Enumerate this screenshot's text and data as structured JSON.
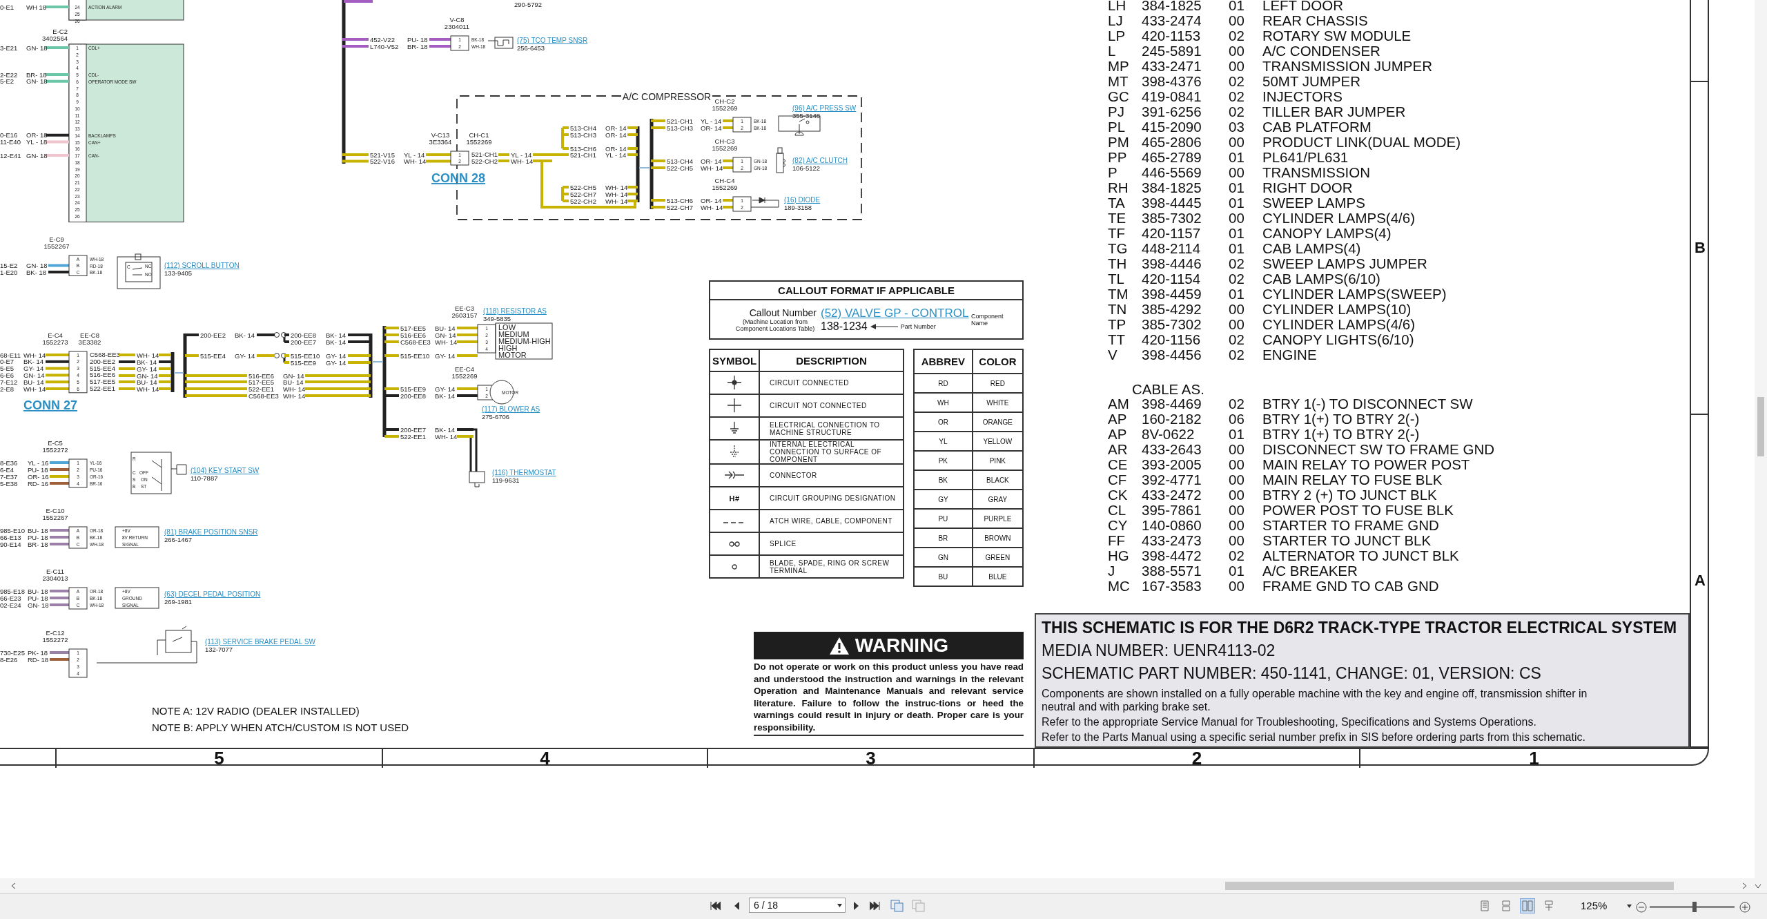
{
  "schematic": {
    "module": {
      "sections": [
        {
          "pins": [
            {
              "number": "24",
              "label": "ACTION ALARM",
              "wire": {
                "circuit": "0-E1",
                "wire": "WH 18",
                "color": "#6cc7a8"
              }
            },
            {
              "number": "25"
            },
            {
              "number": "26"
            }
          ]
        },
        {
          "refs": [
            "E-C2",
            "3402564"
          ],
          "pins": [
            {
              "number": "1",
              "label": "CDL+",
              "wire": {
                "circuit": "3-E21",
                "wire": "GN- 18",
                "color": "#6cc7a8"
              }
            },
            {
              "number": "2"
            },
            {
              "number": "3"
            },
            {
              "number": "4"
            },
            {
              "number": "5",
              "label": "CDL-",
              "wire": {
                "circuit": "2-E22",
                "wire": "BR- 18",
                "color": "#6cc7a8"
              }
            },
            {
              "number": "6",
              "label": "OPERATOR MODE SW",
              "wire": {
                "circuit": "5-E2",
                "wire": "GN- 18",
                "color": "#6cc7a8"
              }
            },
            {
              "number": "7"
            },
            {
              "number": "8"
            },
            {
              "number": "9"
            },
            {
              "number": "10"
            },
            {
              "number": "11"
            },
            {
              "number": "12"
            },
            {
              "number": "13"
            },
            {
              "number": "14",
              "label": "BACKLAMPS",
              "wire": {
                "circuit": "0-E16",
                "wire": "OR- 18",
                "color": "#222222"
              }
            },
            {
              "number": "15",
              "label": "CAN+",
              "wire": {
                "circuit": "11-E40",
                "wire": "YL - 18",
                "color": "#f0c4cc"
              }
            },
            {
              "number": "16"
            },
            {
              "number": "17",
              "label": "CAN-",
              "wire": {
                "circuit": "12-E41",
                "wire": "GN- 18",
                "color": "#f0c4cc"
              }
            },
            {
              "number": "18"
            },
            {
              "number": "19"
            },
            {
              "number": "20"
            },
            {
              "number": "21"
            },
            {
              "number": "22"
            },
            {
              "number": "23"
            },
            {
              "number": "24"
            },
            {
              "number": "25"
            },
            {
              "number": "26"
            }
          ]
        }
      ]
    },
    "top_part_number": "290-5792",
    "compressor_label": "A/C COMPRESSOR",
    "connectors": [
      {
        "refs": [
          [
            "V-C8",
            "2304011"
          ]
        ],
        "wires": [
          {
            "circuit": "452-V22",
            "wire": "PU- 18",
            "color": "#a35cbf"
          },
          {
            "circuit": "L740-V52",
            "wire": "BR- 18",
            "color": "#a35cbf"
          }
        ],
        "pins": [
          "1",
          "2"
        ],
        "pin_wires": [
          "BK-18",
          "WH-18"
        ],
        "device": {
          "kind": "temp_sensor"
        },
        "callout": "(75) TCO TEMP SNSR",
        "part_number": "256-6453"
      },
      {
        "refs": [
          [
            "V-C13",
            "3E3364"
          ],
          [
            "CH-C1",
            "1552269"
          ]
        ],
        "wires": [
          {
            "circuit": "521-V15",
            "wire": "YL - 14",
            "color": "#c8b400"
          },
          {
            "circuit": "522-V16",
            "wire": "WH- 14",
            "color": "#c8b400"
          }
        ],
        "pins": [
          "1",
          "2"
        ],
        "pin_wires": [
          "521-CH1",
          "522-CH2"
        ],
        "link": "CONN 28"
      },
      {
        "refs": [
          [
            "CH-C2",
            "1552269"
          ]
        ],
        "wires": [
          {
            "circuit": "521-CH1",
            "wire": "YL - 14",
            "color": "#c8b400"
          },
          {
            "circuit": "513-CH3",
            "wire": "OR- 14",
            "color": "#c8b400"
          }
        ],
        "pins": [
          "1",
          "2"
        ],
        "pin_wires": [
          "BK-18",
          "BK-18"
        ],
        "device": {
          "kind": "pressure_switch"
        },
        "callout": "(96) A/C PRESS SW",
        "part_number": "355-3148"
      },
      {
        "refs": [
          [
            "CH-C3",
            "1552269"
          ]
        ],
        "wires": [
          {
            "circuit": "513-CH4",
            "wire": "OR- 14",
            "color": "#c8b400"
          },
          {
            "circuit": "522-CH5",
            "wire": "WH- 14",
            "color": "#c8b400"
          }
        ],
        "pins": [
          "1",
          "2"
        ],
        "pin_wires": [
          "GN-18",
          "GN-18"
        ],
        "device": {
          "kind": "clutch"
        },
        "callout": "(82) A/C CLUTCH",
        "part_number": "106-5122"
      },
      {
        "refs": [
          [
            "CH-C4",
            "1552269"
          ]
        ],
        "wires": [
          {
            "circuit": "513-CH6",
            "wire": "OR- 14",
            "color": "#c8b400"
          },
          {
            "circuit": "522-CH7",
            "wire": "WH- 14",
            "color": "#c8b400"
          }
        ],
        "pins": [
          "1",
          "2"
        ],
        "device": {
          "kind": "diode"
        },
        "callout": "(16) DIODE",
        "part_number": "189-3158"
      },
      {
        "refs": [
          [
            "E-C9",
            "1552267"
          ]
        ],
        "wires": [
          {
            "circuit": "15-E2",
            "wire": "GN- 18",
            "color": "#4fa6d6"
          },
          {
            "circuit": "1-E20",
            "wire": "BK- 18",
            "color": "#222222"
          }
        ],
        "pins": [
          "A",
          "B",
          "C"
        ],
        "pin_wires": [
          "WH-18",
          "RD-18",
          "BK-18"
        ],
        "device": {
          "kind": "push_switch",
          "labels": [
            "C",
            "NC",
            "NO"
          ]
        },
        "callout": "(112) SCROLL BUTTON",
        "part_number": "133-9405"
      },
      {
        "refs": [
          [
            "E-C4",
            "1552273"
          ],
          [
            "EE-C8",
            "3E3382"
          ]
        ],
        "wires": [
          {
            "circuit": "68-E11",
            "wire": "WH- 14",
            "color": "#c8b400"
          },
          {
            "circuit": "0-E7",
            "wire": "BK- 14",
            "color": "#222222"
          },
          {
            "circuit": "5-E5",
            "wire": "GY- 14",
            "color": "#c8b400"
          },
          {
            "circuit": "6-E6",
            "wire": "GN- 14",
            "color": "#c8b400"
          },
          {
            "circuit": "7-E12",
            "wire": "BU- 14",
            "color": "#c8b400"
          },
          {
            "circuit": "2-E8",
            "wire": "WH- 14",
            "color": "#c8b400"
          }
        ],
        "pins": [
          "1",
          "2",
          "3",
          "4",
          "5",
          "6"
        ],
        "pin_wires": [
          "C568-EE3",
          "200-EE2",
          "515-EE4",
          "516-EE6",
          "517-EE5",
          "522-EE1"
        ],
        "link": "CONN 27"
      },
      {
        "refs": [
          [
            "EE-C3",
            "2603157"
          ]
        ],
        "wires": [
          {
            "circuit": "517-EE5",
            "wire": "BU- 14",
            "color": "#c8b400"
          },
          {
            "circuit": "516-EE6",
            "wire": "GN- 14",
            "color": "#c8b400"
          },
          {
            "circuit": "C568-EE3",
            "wire": "WH- 14",
            "color": "#c8b400"
          },
          {
            "circuit": "515-EE10",
            "wire": "GY- 14",
            "color": "#c8b400"
          }
        ],
        "pins": [
          "1",
          "2",
          "3",
          "4"
        ],
        "device": {
          "kind": "resistor",
          "labels": [
            "LOW",
            "MEDIUM",
            "MEDIUM-HIGH",
            "HIGH",
            "MOTOR"
          ]
        },
        "callout": "(118) RESISTOR AS",
        "part_number": "349-5835"
      },
      {
        "refs": [
          [
            "EE-C4",
            "1552269"
          ]
        ],
        "wires": [
          {
            "circuit": "515-EE9",
            "wire": "GY- 14",
            "color": "#c8b400"
          },
          {
            "circuit": "200-EE8",
            "wire": "BK- 14",
            "color": "#222222"
          }
        ],
        "pins": [
          "1",
          "2"
        ],
        "device": {
          "kind": "motor",
          "labels": [
            "MOTOR"
          ]
        },
        "callout": "(117) BLOWER AS",
        "part_number": "275-6706"
      },
      {
        "refs": [
          [
            "E-C5",
            "1552272"
          ]
        ],
        "wires": [
          {
            "circuit": "8-E36",
            "wire": "YL - 16",
            "color": "#4fa6d6"
          },
          {
            "circuit": "6-E4",
            "wire": "PU- 18",
            "color": "#a0603c"
          },
          {
            "circuit": "7-E37",
            "wire": "OR- 16",
            "color": "#c8b400"
          },
          {
            "circuit": "5-E38",
            "wire": "RD- 16",
            "color": "#a0603c"
          }
        ],
        "pins": [
          "1",
          "2",
          "3",
          "4"
        ],
        "pin_wires": [
          "YL-16",
          "PU-16",
          "OR-16",
          "BR-16"
        ],
        "device": {
          "kind": "key_switch",
          "labels": [
            "R",
            "C",
            "OFF",
            "S",
            "ON",
            "B",
            "ST"
          ]
        },
        "callout": "(104) KEY START SW",
        "part_number": "110-7887"
      },
      {
        "wires": [
          {
            "circuit": "200-EE7",
            "wire": "BK- 14",
            "color": "#222222"
          },
          {
            "circuit": "522-EE1",
            "wire": "WH- 14",
            "color": "#c8b400"
          }
        ],
        "device": {
          "kind": "thermostat"
        },
        "callout": "(116) THERMOSTAT",
        "part_number": "119-9631"
      },
      {
        "refs": [
          [
            "E-C10",
            "1552267"
          ]
        ],
        "wires": [
          {
            "circuit": "985-E10",
            "wire": "BU- 18",
            "color": "#9b80a8"
          },
          {
            "circuit": "66-E13",
            "wire": "PU- 18",
            "color": "#9b80a8"
          },
          {
            "circuit": "90-E14",
            "wire": "BR- 18",
            "color": "#9b80a8"
          }
        ],
        "pins": [
          "A",
          "B",
          "C"
        ],
        "pin_wires": [
          "OR-18",
          "BK-18",
          "WH-18"
        ],
        "device": {
          "kind": "sensor",
          "labels": [
            "+8V",
            "8V RETURN",
            "SIGNAL"
          ]
        },
        "callout": "(81) BRAKE POSITION SNSR",
        "part_number": "266-1467"
      },
      {
        "refs": [
          [
            "E-C11",
            "2304013"
          ]
        ],
        "wires": [
          {
            "circuit": "985-E18",
            "wire": "BU- 18",
            "color": "#9b80a8"
          },
          {
            "circuit": "66-E23",
            "wire": "PU- 18",
            "color": "#9b80a8"
          },
          {
            "circuit": "02-E24",
            "wire": "GN- 18",
            "color": "#9b80a8"
          }
        ],
        "pins": [
          "A",
          "B",
          "C"
        ],
        "pin_wires": [
          "OR-18",
          "BK-18",
          "WH-18"
        ],
        "device": {
          "kind": "sensor",
          "labels": [
            "+8V",
            "GROUND",
            "SIGNAL"
          ]
        },
        "callout": "(63) DECEL PEDAL POSITION",
        "part_number": "269-1981"
      },
      {
        "refs": [
          [
            "E-C12",
            "1552272"
          ]
        ],
        "wires": [
          {
            "circuit": "730-E25",
            "wire": "PK- 18",
            "color": "#9b80a8"
          },
          {
            "circuit": "8-E26",
            "wire": "RD- 18",
            "color": "#a0603c"
          }
        ],
        "pins": [
          "1",
          "2",
          "3",
          "4"
        ],
        "device": {
          "kind": "pedal_switch"
        },
        "callout": "(113) SERVICE BRAKE PEDAL SW",
        "part_number": "132-7077"
      }
    ],
    "runs": [
      {
        "wires": [
          {
            "circuit": "513-CH4",
            "wire": "OR- 14",
            "color": "#c8b400"
          },
          {
            "circuit": "513-CH3",
            "wire": "OR- 14",
            "color": "#c8b400"
          },
          {
            "circuit": "513-CH6",
            "wire": "OR- 14",
            "color": "#c8b400"
          },
          {
            "circuit": "521-CH1",
            "wire": "YL - 14",
            "color": "#c8b400"
          },
          {
            "circuit": "522-CH5",
            "wire": "WH- 14",
            "color": "#c8b400"
          },
          {
            "circuit": "522-CH7",
            "wire": "WH- 14",
            "color": "#c8b400"
          },
          {
            "circuit": "522-CH2",
            "wire": "WH- 14",
            "color": "#c8b400"
          }
        ]
      },
      {
        "wires": [
          {
            "wire": "YL - 14",
            "color": "#c8b400"
          },
          {
            "wire": "WH- 14",
            "color": "#c8b400"
          }
        ]
      },
      {
        "wires": [
          {
            "wire": "WH- 14",
            "color": "#c8b400"
          },
          {
            "wire": "BK- 14",
            "color": "#222222"
          },
          {
            "wire": "GY- 14",
            "color": "#c8b400"
          },
          {
            "wire": "GN- 14",
            "color": "#c8b400"
          },
          {
            "wire": "BU- 14",
            "color": "#c8b400"
          },
          {
            "wire": "WH- 14",
            "color": "#c8b400"
          }
        ]
      },
      {
        "wires": [
          {
            "circuit": "200-EE2",
            "wire": "BK- 14",
            "color": "#222222"
          },
          {
            "circuit": "515-EE4",
            "wire": "GY- 14",
            "color": "#c8b400"
          }
        ]
      },
      {
        "wires": [
          {
            "circuit": "200-EE8",
            "wire": "BK- 14",
            "color": "#222222"
          },
          {
            "circuit": "200-EE7",
            "wire": "BK- 14",
            "color": "#222222"
          },
          {
            "circuit": "515-EE10",
            "wire": "GY- 14",
            "color": "#c8b400"
          },
          {
            "circuit": "515-EE9",
            "wire": "GY- 14",
            "color": "#c8b400"
          }
        ]
      },
      {
        "wires": [
          {
            "circuit": "516-EE6",
            "wire": "GN- 14",
            "color": "#c8b400"
          },
          {
            "circuit": "517-EE5",
            "wire": "BU- 14",
            "color": "#c8b400"
          },
          {
            "circuit": "522-EE1",
            "wire": "WH- 14",
            "color": "#c8b400"
          },
          {
            "circuit": "C568-EE3",
            "wire": "WH- 14",
            "color": "#c8b400"
          }
        ]
      }
    ]
  },
  "notes": [
    "NOTE A:  12V RADIO (DEALER INSTALLED)",
    "NOTE B:  APPLY WHEN ATCH/CUSTOM IS NOT USED"
  ],
  "callout_format": {
    "title": "CALLOUT FORMAT IF APPLICABLE",
    "callout_label": "Callout Number",
    "callout_hint": "(Machine Location from Component Locations Table)",
    "example_link": "(52) VALVE GP - CONTROL",
    "example_part": "138-1234",
    "component_label": "Component Name",
    "part_label": "Part Number"
  },
  "symbol_table": {
    "columns": [
      "SYMBOL",
      "DESCRIPTION"
    ],
    "rows": [
      {
        "kind": "connected",
        "description": "CIRCUIT CONNECTED"
      },
      {
        "kind": "not_connected",
        "description": "CIRCUIT NOT CONNECTED"
      },
      {
        "kind": "ground",
        "description": "ELECTRICAL CONNECTION TO MACHINE STRUCTURE"
      },
      {
        "kind": "internal_ground",
        "description": "INTERNAL ELECTRICAL CONNECTION TO SURFACE OF COMPONENT"
      },
      {
        "kind": "connector",
        "description": "CONNECTOR"
      },
      {
        "kind": "text",
        "symbol": "H#",
        "description": "CIRCUIT GROUPING DESIGNATION"
      },
      {
        "kind": "dashed",
        "description": "ATCH WIRE, CABLE, COMPONENT"
      },
      {
        "kind": "splice",
        "description": "SPLICE"
      },
      {
        "kind": "terminal",
        "description": "BLADE, SPADE, RING OR SCREW TERMINAL"
      }
    ]
  },
  "color_table": {
    "columns": [
      "ABBREV",
      "COLOR"
    ],
    "rows": [
      {
        "abbrev": "RD",
        "name": "RED"
      },
      {
        "abbrev": "WH",
        "name": "WHITE"
      },
      {
        "abbrev": "OR",
        "name": "ORANGE"
      },
      {
        "abbrev": "YL",
        "name": "YELLOW"
      },
      {
        "abbrev": "PK",
        "name": "PINK"
      },
      {
        "abbrev": "BK",
        "name": "BLACK"
      },
      {
        "abbrev": "GY",
        "name": "GRAY"
      },
      {
        "abbrev": "PU",
        "name": "PURPLE"
      },
      {
        "abbrev": "BR",
        "name": "BROWN"
      },
      {
        "abbrev": "GN",
        "name": "GREEN"
      },
      {
        "abbrev": "BU",
        "name": "BLUE"
      }
    ]
  },
  "warning": {
    "title": "WARNING",
    "text": "Do not operate or work on this product unless you have read and understood the instruction and warnings in the relevant Operation and Maintenance Manuals and relevant service literature. Failure to follow the instruc-tions or heed the warnings could result in injury or death. Proper care is your responsibility."
  },
  "harnesses": [
    {
      "code": "LH",
      "part": "384-1825",
      "change": "01",
      "name": "LEFT DOOR"
    },
    {
      "code": "LJ",
      "part": "433-2474",
      "change": "00",
      "name": "REAR CHASSIS"
    },
    {
      "code": "LP",
      "part": "420-1153",
      "change": "02",
      "name": "ROTARY SW MODULE"
    },
    {
      "code": "L",
      "part": "245-5891",
      "change": "00",
      "name": "A/C CONDENSER"
    },
    {
      "code": "MP",
      "part": "433-2471",
      "change": "00",
      "name": "TRANSMISSION JUMPER"
    },
    {
      "code": "MT",
      "part": "398-4376",
      "change": "02",
      "name": "50MT JUMPER"
    },
    {
      "code": "GC",
      "part": "419-0841",
      "change": "02",
      "name": "INJECTORS"
    },
    {
      "code": "PJ",
      "part": "391-6256",
      "change": "02",
      "name": "TILLER BAR JUMPER"
    },
    {
      "code": "PL",
      "part": "415-2090",
      "change": "03",
      "name": "CAB PLATFORM"
    },
    {
      "code": "PM",
      "part": "465-2806",
      "change": "00",
      "name": "PRODUCT LINK(DUAL MODE)"
    },
    {
      "code": "PP",
      "part": "465-2789",
      "change": "01",
      "name": "PL641/PL631"
    },
    {
      "code": "P",
      "part": "446-5569",
      "change": "00",
      "name": "TRANSMISSION"
    },
    {
      "code": "RH",
      "part": "384-1825",
      "change": "01",
      "name": "RIGHT DOOR"
    },
    {
      "code": "TA",
      "part": "398-4445",
      "change": "01",
      "name": "SWEEP LAMPS"
    },
    {
      "code": "TE",
      "part": "385-7302",
      "change": "00",
      "name": "CYLINDER LAMPS(4/6)"
    },
    {
      "code": "TF",
      "part": "420-1157",
      "change": "01",
      "name": "CANOPY LAMPS(4)"
    },
    {
      "code": "TG",
      "part": "448-2114",
      "change": "01",
      "name": "CAB LAMPS(4)"
    },
    {
      "code": "TH",
      "part": "398-4446",
      "change": "02",
      "name": "SWEEP LAMPS JUMPER"
    },
    {
      "code": "TL",
      "part": "420-1154",
      "change": "02",
      "name": "CAB LAMPS(6/10)"
    },
    {
      "code": "TM",
      "part": "398-4459",
      "change": "01",
      "name": "CYLINDER LAMPS(SWEEP)"
    },
    {
      "code": "TN",
      "part": "385-4292",
      "change": "00",
      "name": "CYLINDER LAMPS(10)"
    },
    {
      "code": "TP",
      "part": "385-7302",
      "change": "00",
      "name": "CYLINDER LAMPS(4/6)"
    },
    {
      "code": "TT",
      "part": "420-1156",
      "change": "02",
      "name": "CANOPY LIGHTS(6/10)"
    },
    {
      "code": "V",
      "part": "398-4456",
      "change": "02",
      "name": "ENGINE"
    }
  ],
  "cable_heading": "CABLE AS.",
  "cables": [
    {
      "code": "AM",
      "part": "398-4469",
      "change": "02",
      "name": "BTRY 1(-) TO DISCONNECT SW"
    },
    {
      "code": "AP",
      "part": "160-2182",
      "change": "06",
      "name": "BTRY 1(+) TO BTRY 2(-)"
    },
    {
      "code": "AP",
      "part": "8V-0622",
      "change": "01",
      "name": "BTRY 1(+) TO BTRY 2(-)"
    },
    {
      "code": "AR",
      "part": "433-2643",
      "change": "00",
      "name": "DISCONNECT SW TO FRAME GND"
    },
    {
      "code": "CE",
      "part": "393-2005",
      "change": "00",
      "name": "MAIN RELAY TO POWER POST"
    },
    {
      "code": "CF",
      "part": "392-4771",
      "change": "00",
      "name": "MAIN RELAY TO FUSE BLK"
    },
    {
      "code": "CK",
      "part": "433-2472",
      "change": "00",
      "name": "BTRY 2 (+) TO JUNCT BLK"
    },
    {
      "code": "CL",
      "part": "395-7861",
      "change": "00",
      "name": "POWER POST TO FUSE BLK"
    },
    {
      "code": "CY",
      "part": "140-0860",
      "change": "00",
      "name": "STARTER TO FRAME GND"
    },
    {
      "code": "FF",
      "part": "433-2473",
      "change": "00",
      "name": "STARTER TO JUNCT BLK"
    },
    {
      "code": "HG",
      "part": "398-4472",
      "change": "02",
      "name": "ALTERNATOR TO JUNCT BLK"
    },
    {
      "code": "J",
      "part": "388-5571",
      "change": "01",
      "name": "A/C BREAKER"
    },
    {
      "code": "MC",
      "part": "167-3583",
      "change": "00",
      "name": "FRAME GND TO CAB GND"
    }
  ],
  "title_block": {
    "title": "THIS SCHEMATIC IS FOR THE D6R2 TRACK-TYPE TRACTOR ELECTRICAL SYSTEM",
    "media": "MEDIA NUMBER: UENR4113-02",
    "part": "SCHEMATIC PART NUMBER: 450-1141, CHANGE: 01, VERSION: CS",
    "notes": [
      "Components are shown installed on a fully operable machine with the key and engine off, transmission shifter in neutral and with parking brake set.",
      "Refer to the appropriate Service Manual for Troubleshooting, Specifications and Systems Operations.",
      "Refer to the Parts Manual using a specific serial number prefix in SIS before ordering parts from this schematic."
    ]
  },
  "zones": {
    "columns": [
      "5",
      "4",
      "3",
      "2",
      "1"
    ],
    "rows": [
      "B",
      "A"
    ]
  },
  "viewer": {
    "page": "6 / 18",
    "zoom": "125%",
    "zoom_slider": {
      "level": 0.53
    },
    "view_modes": [
      {
        "selected": false
      },
      {
        "selected": false
      },
      {
        "selected": true
      },
      {
        "selected": false
      }
    ]
  }
}
